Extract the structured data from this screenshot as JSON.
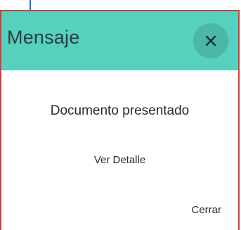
{
  "dialog": {
    "title": "Mensaje",
    "message": "Documento presentado",
    "detail_link": "Ver Detalle",
    "close_link": "Cerrar",
    "close_icon": "close-icon"
  },
  "colors": {
    "header_bg": "#55d1bd",
    "close_button_bg": "#4bb7a6",
    "border": "#d93a3a",
    "focus_line": "#1e6fd0"
  }
}
